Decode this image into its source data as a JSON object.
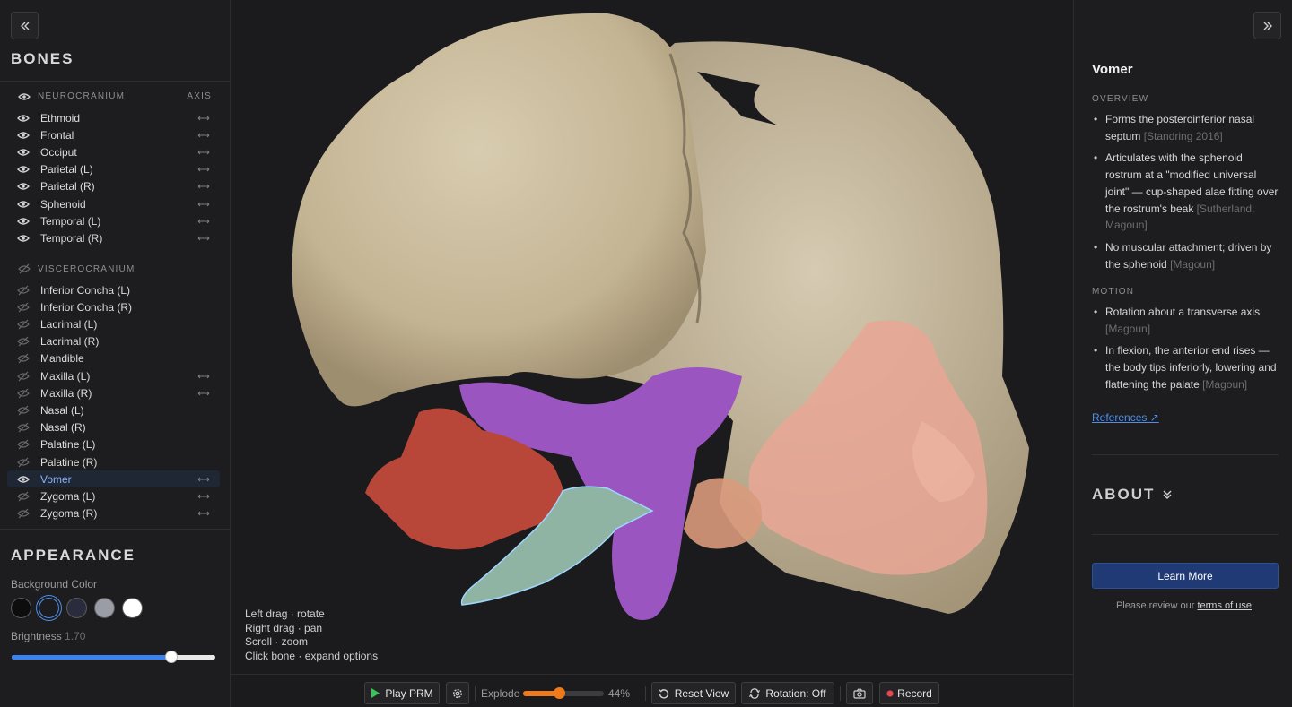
{
  "left_panel": {
    "title": "BONES",
    "neurocranium": {
      "label": "NEUROCRANIUM",
      "axis_label": "AXIS",
      "items": [
        {
          "label": "Ethmoid",
          "visible": true,
          "axis": true
        },
        {
          "label": "Frontal",
          "visible": true,
          "axis": true
        },
        {
          "label": "Occiput",
          "visible": true,
          "axis": true
        },
        {
          "label": "Parietal (L)",
          "visible": true,
          "axis": true
        },
        {
          "label": "Parietal (R)",
          "visible": true,
          "axis": true
        },
        {
          "label": "Sphenoid",
          "visible": true,
          "axis": true
        },
        {
          "label": "Temporal (L)",
          "visible": true,
          "axis": true
        },
        {
          "label": "Temporal (R)",
          "visible": true,
          "axis": true
        }
      ]
    },
    "viscerocranium": {
      "label": "VISCEROCRANIUM",
      "items": [
        {
          "label": "Inferior Concha (L)",
          "visible": false,
          "axis": false
        },
        {
          "label": "Inferior Concha (R)",
          "visible": false,
          "axis": false
        },
        {
          "label": "Lacrimal (L)",
          "visible": false,
          "axis": false
        },
        {
          "label": "Lacrimal (R)",
          "visible": false,
          "axis": false
        },
        {
          "label": "Mandible",
          "visible": false,
          "axis": false
        },
        {
          "label": "Maxilla (L)",
          "visible": false,
          "axis": true
        },
        {
          "label": "Maxilla (R)",
          "visible": false,
          "axis": true
        },
        {
          "label": "Nasal (L)",
          "visible": false,
          "axis": false
        },
        {
          "label": "Nasal (R)",
          "visible": false,
          "axis": false
        },
        {
          "label": "Palatine (L)",
          "visible": false,
          "axis": false
        },
        {
          "label": "Palatine (R)",
          "visible": false,
          "axis": false
        },
        {
          "label": "Vomer",
          "visible": true,
          "axis": true,
          "selected": true
        },
        {
          "label": "Zygoma (L)",
          "visible": false,
          "axis": true
        },
        {
          "label": "Zygoma (R)",
          "visible": false,
          "axis": true
        }
      ]
    },
    "appearance": {
      "title": "APPEARANCE",
      "background_label": "Background Color",
      "swatches": [
        "#0d0d0e",
        "#1c1c1f",
        "#2a2c3e",
        "#9a9ca6",
        "#ffffff"
      ],
      "active_swatch": 1,
      "brightness_label": "Brightness",
      "brightness_value": "1.70",
      "brightness_fraction": 0.785
    }
  },
  "viewport": {
    "hints": [
      "Left drag · rotate",
      "Right drag · pan",
      "Scroll · zoom",
      "Click bone · expand options"
    ]
  },
  "toolbar": {
    "play_label": "Play PRM",
    "explode_label": "Explode",
    "explode_value": "44%",
    "explode_fraction": 0.44,
    "reset_label": "Reset View",
    "rotation_label": "Rotation: Off",
    "record_label": "Record",
    "accent": "#f07a1a"
  },
  "right_panel": {
    "bone_name": "Vomer",
    "overview_label": "OVERVIEW",
    "overview": [
      {
        "text": "Forms the posteroinferior nasal septum ",
        "cite": "[Standring 2016]"
      },
      {
        "text": "Articulates with the sphenoid rostrum at a \"modified universal joint\" — cup-shaped alae fitting over the rostrum's beak ",
        "cite": "[Sutherland; Magoun]"
      },
      {
        "text": "No muscular attachment; driven by the sphenoid ",
        "cite": "[Magoun]"
      }
    ],
    "motion_label": "MOTION",
    "motion": [
      {
        "text": "Rotation about a transverse axis ",
        "cite": "[Magoun]"
      },
      {
        "text": "In flexion, the anterior end rises — the body tips inferiorly, lowering and flattening the palate ",
        "cite": "[Magoun]"
      }
    ],
    "references_label": "References ↗",
    "about_label": "ABOUT",
    "learn_more_label": "Learn More",
    "review_prefix": "Please review our ",
    "review_link": "terms of use",
    "review_suffix": "."
  }
}
